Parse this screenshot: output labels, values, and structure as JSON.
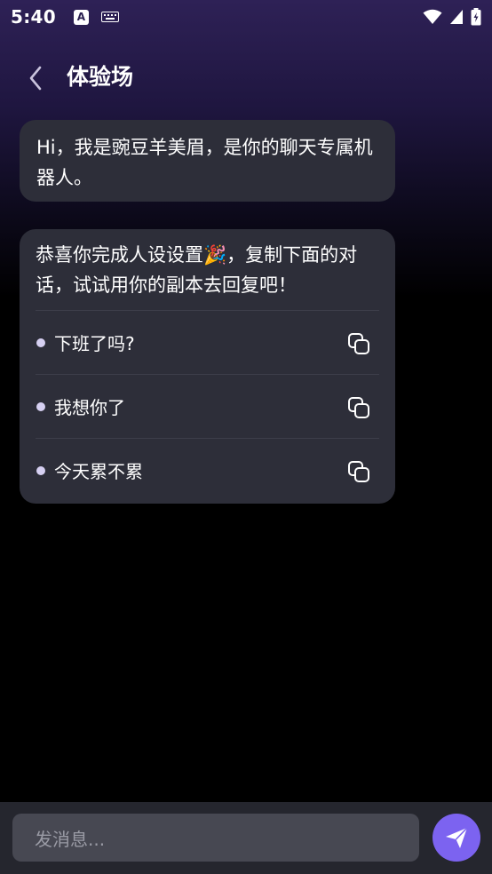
{
  "status_bar": {
    "time": "5:40",
    "notification_icon_letter": "A",
    "icons": [
      "accessibility-icon",
      "keyboard-icon",
      "wifi-icon",
      "signal-icon",
      "battery-icon"
    ]
  },
  "header": {
    "title": "体验场",
    "back_icon": "chevron-left-icon"
  },
  "messages": [
    {
      "text": "Hi，我是豌豆羊美眉，是你的聊天专属机器人。"
    },
    {
      "text": "恭喜你完成人设设置🎉，复制下面的对话，试试用你的副本去回复吧！",
      "suggestions": [
        {
          "text": "下班了吗?",
          "icon": "copy-icon"
        },
        {
          "text": "我想你了",
          "icon": "copy-icon"
        },
        {
          "text": "今天累不累",
          "icon": "copy-icon"
        }
      ]
    }
  ],
  "input": {
    "placeholder": "发消息...",
    "send_icon": "send-icon"
  },
  "colors": {
    "accent": "#7c63f0",
    "bubble": "#2d2e39",
    "header_gradient_top": "#2e2156",
    "input_bar": "#25262e",
    "input_field": "#474852",
    "dot": "#d6d0f2"
  }
}
